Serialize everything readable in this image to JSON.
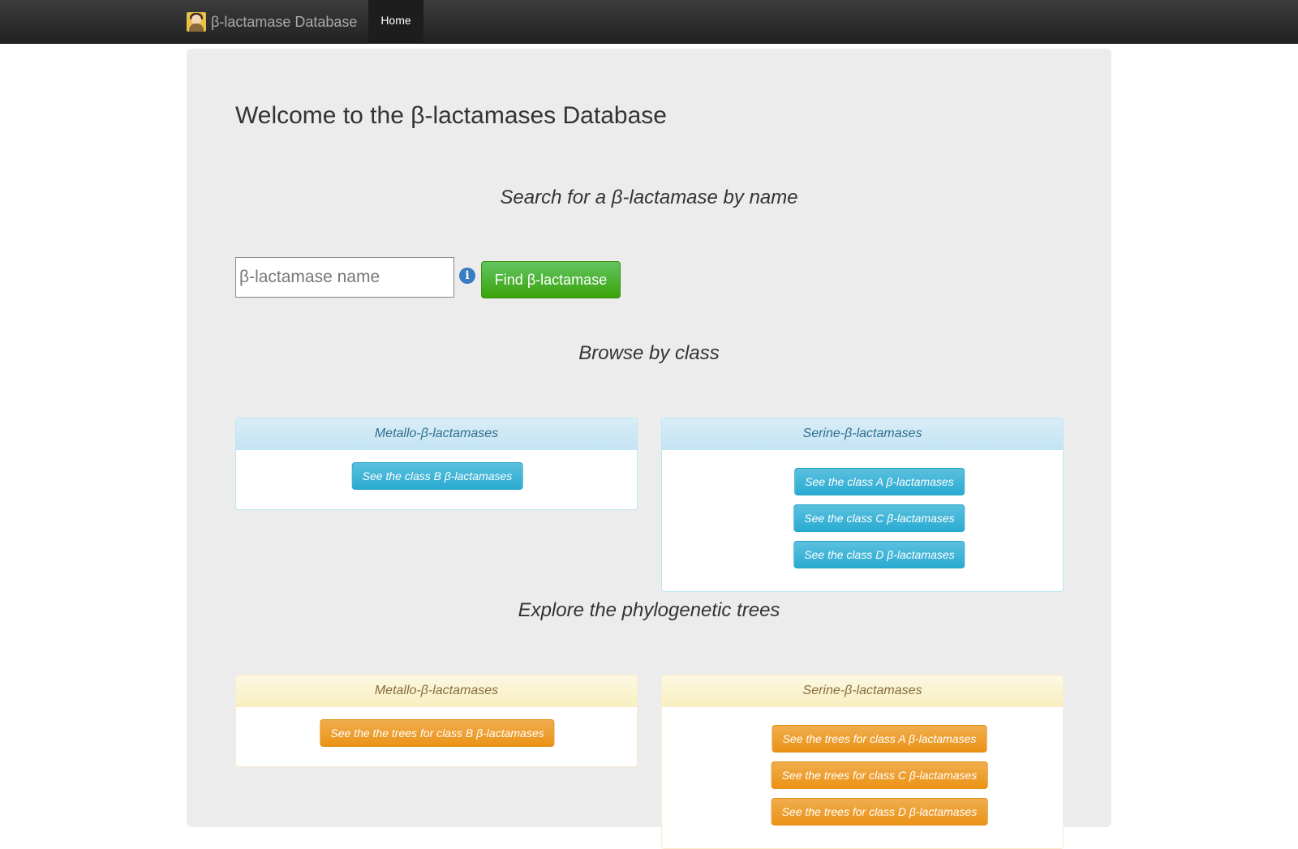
{
  "navbar": {
    "brand": "β-lactamase Database",
    "home": "Home"
  },
  "main": {
    "title": "Welcome to the β-lactamases Database",
    "search_section": "Search for a β-lactamase by name",
    "search_placeholder": "β-lactamase name",
    "find_button": "Find β-lactamase",
    "info_icon_glyph": "i",
    "browse_section": "Browse by class",
    "trees_section": "Explore the phylogenetic trees"
  },
  "browse": {
    "metallo": {
      "heading": "Metallo-β-lactamases",
      "buttons": [
        "See the class B β-lactamases"
      ]
    },
    "serine": {
      "heading": "Serine-β-lactamases",
      "buttons": [
        "See the class A β-lactamases",
        "See the class C β-lactamases",
        "See the class D β-lactamases"
      ]
    }
  },
  "trees": {
    "metallo": {
      "heading": "Metallo-β-lactamases",
      "buttons": [
        "See the the trees for class B β-lactamases"
      ]
    },
    "serine": {
      "heading": "Serine-β-lactamases",
      "buttons": [
        "See the trees for class A β-lactamases",
        "See the trees for class C β-lactamases",
        "See the trees for class D β-lactamases"
      ]
    }
  },
  "colors": {
    "info": "#2aabd2",
    "warning": "#eb9316",
    "success": "#3aa30a",
    "navbar": "#222222"
  }
}
